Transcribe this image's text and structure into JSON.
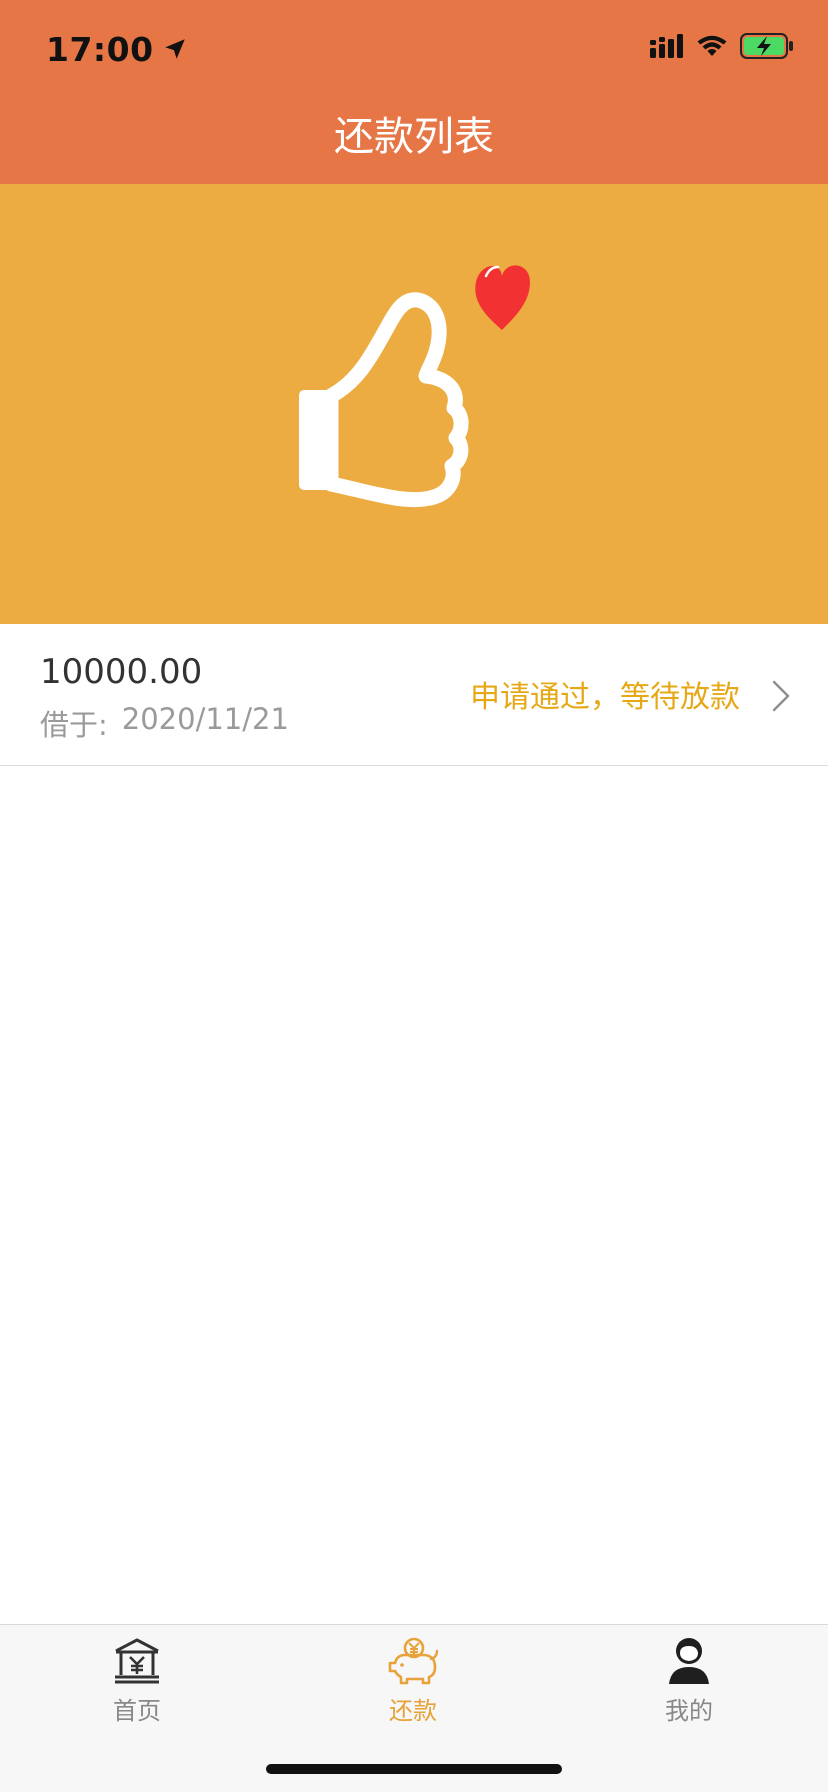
{
  "status_bar": {
    "time": "17:00"
  },
  "nav": {
    "title": "还款列表"
  },
  "banner": {
    "icon": "thumbs-up-heart"
  },
  "record": {
    "amount": "10000.00",
    "date_label": "借于:",
    "date": "2020/11/21",
    "status": "申请通过，等待放款"
  },
  "tabbar": {
    "home_label": "首页",
    "repay_label": "还款",
    "mine_label": "我的",
    "active": "还款"
  },
  "colors": {
    "header": "#E67646",
    "banner": "#ECAC42",
    "status_text": "#E6A817",
    "tab_active": "#E8A23A",
    "tab_inactive": "#888888"
  }
}
